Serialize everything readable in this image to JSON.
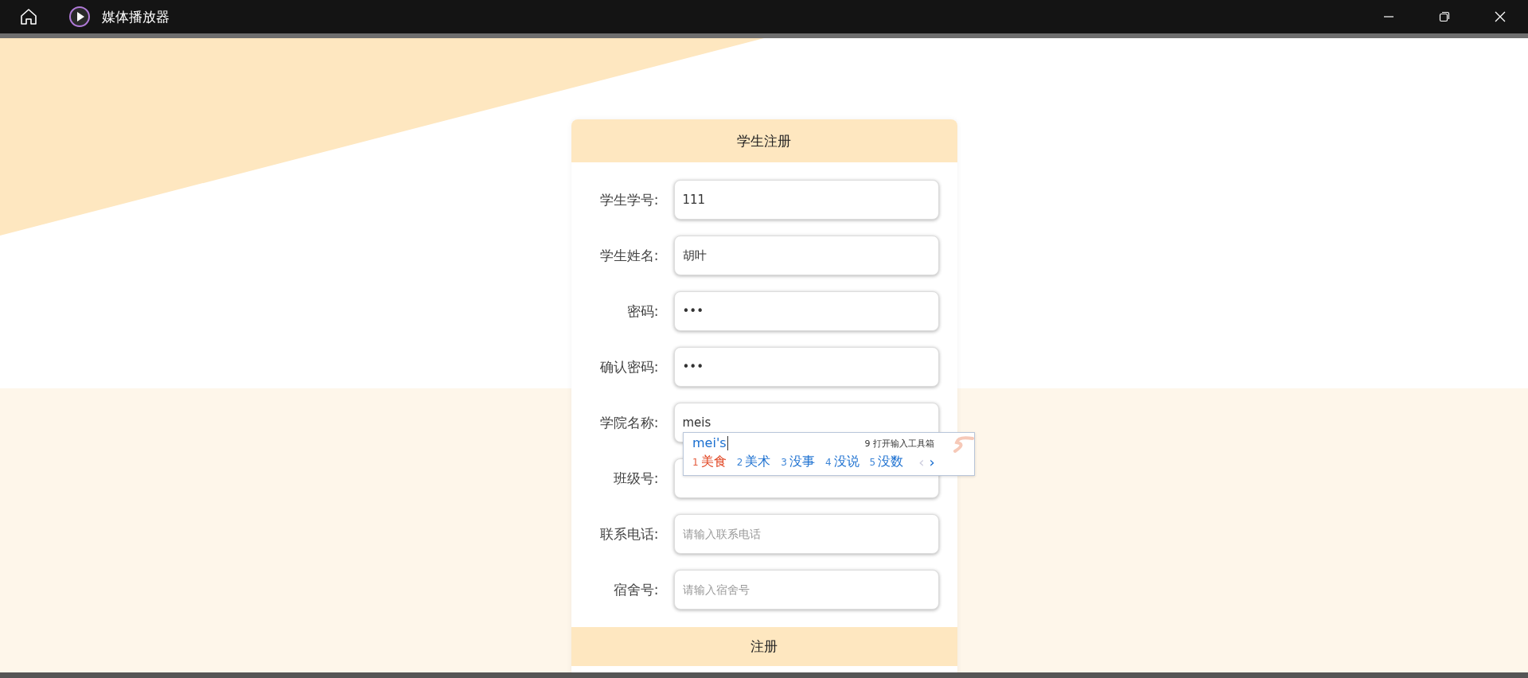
{
  "window": {
    "title": "媒体播放器"
  },
  "form": {
    "title": "学生注册",
    "fields": [
      {
        "label": "学生学号:",
        "value": "111"
      },
      {
        "label": "学生姓名:",
        "value": "胡叶"
      },
      {
        "label": "密码:",
        "value": "•••"
      },
      {
        "label": "确认密码:",
        "value": "•••"
      },
      {
        "label": "学院名称:",
        "value": "meis"
      },
      {
        "label": "班级号:"
      },
      {
        "label": "联系电话:",
        "placeholder": "请输入联系电话"
      },
      {
        "label": "宿舍号:",
        "placeholder": "请输入宿舍号"
      }
    ],
    "submit": "注册"
  },
  "ime": {
    "composition": "mei's",
    "toolbox": "9 打开输入工具箱",
    "candidates": [
      {
        "number": "1",
        "text": "美食",
        "selected": true
      },
      {
        "number": "2",
        "text": "美术",
        "selected": false
      },
      {
        "number": "3",
        "text": "没事",
        "selected": false
      },
      {
        "number": "4",
        "text": "没说",
        "selected": false
      },
      {
        "number": "5",
        "text": "没数",
        "selected": false
      }
    ],
    "prev": {
      "label": "‹",
      "disabled": true
    },
    "next": {
      "label": "›",
      "disabled": false
    }
  }
}
